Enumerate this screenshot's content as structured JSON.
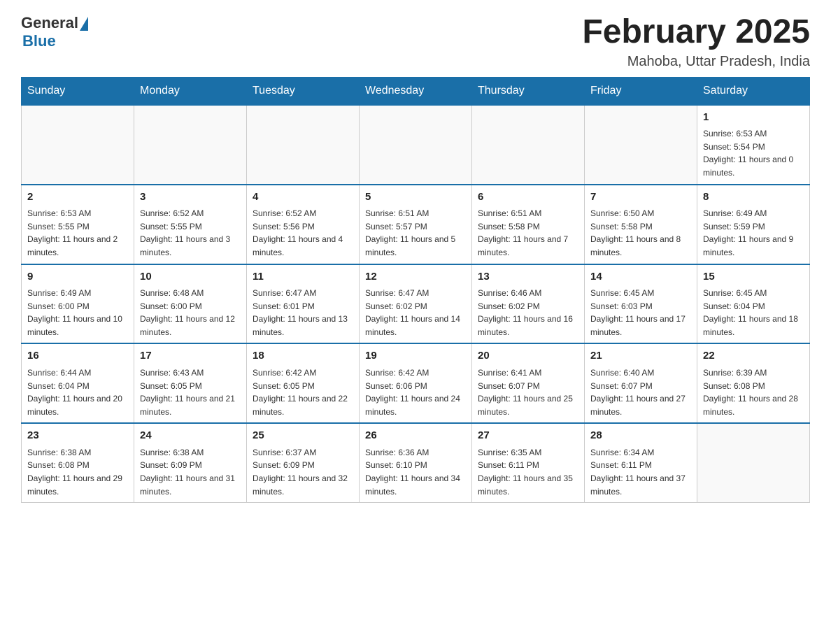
{
  "header": {
    "logo_general": "General",
    "logo_blue": "Blue",
    "month_title": "February 2025",
    "location": "Mahoba, Uttar Pradesh, India"
  },
  "days_of_week": [
    "Sunday",
    "Monday",
    "Tuesday",
    "Wednesday",
    "Thursday",
    "Friday",
    "Saturday"
  ],
  "weeks": [
    [
      {
        "day": "",
        "sunrise": "",
        "sunset": "",
        "daylight": ""
      },
      {
        "day": "",
        "sunrise": "",
        "sunset": "",
        "daylight": ""
      },
      {
        "day": "",
        "sunrise": "",
        "sunset": "",
        "daylight": ""
      },
      {
        "day": "",
        "sunrise": "",
        "sunset": "",
        "daylight": ""
      },
      {
        "day": "",
        "sunrise": "",
        "sunset": "",
        "daylight": ""
      },
      {
        "day": "",
        "sunrise": "",
        "sunset": "",
        "daylight": ""
      },
      {
        "day": "1",
        "sunrise": "Sunrise: 6:53 AM",
        "sunset": "Sunset: 5:54 PM",
        "daylight": "Daylight: 11 hours and 0 minutes."
      }
    ],
    [
      {
        "day": "2",
        "sunrise": "Sunrise: 6:53 AM",
        "sunset": "Sunset: 5:55 PM",
        "daylight": "Daylight: 11 hours and 2 minutes."
      },
      {
        "day": "3",
        "sunrise": "Sunrise: 6:52 AM",
        "sunset": "Sunset: 5:55 PM",
        "daylight": "Daylight: 11 hours and 3 minutes."
      },
      {
        "day": "4",
        "sunrise": "Sunrise: 6:52 AM",
        "sunset": "Sunset: 5:56 PM",
        "daylight": "Daylight: 11 hours and 4 minutes."
      },
      {
        "day": "5",
        "sunrise": "Sunrise: 6:51 AM",
        "sunset": "Sunset: 5:57 PM",
        "daylight": "Daylight: 11 hours and 5 minutes."
      },
      {
        "day": "6",
        "sunrise": "Sunrise: 6:51 AM",
        "sunset": "Sunset: 5:58 PM",
        "daylight": "Daylight: 11 hours and 7 minutes."
      },
      {
        "day": "7",
        "sunrise": "Sunrise: 6:50 AM",
        "sunset": "Sunset: 5:58 PM",
        "daylight": "Daylight: 11 hours and 8 minutes."
      },
      {
        "day": "8",
        "sunrise": "Sunrise: 6:49 AM",
        "sunset": "Sunset: 5:59 PM",
        "daylight": "Daylight: 11 hours and 9 minutes."
      }
    ],
    [
      {
        "day": "9",
        "sunrise": "Sunrise: 6:49 AM",
        "sunset": "Sunset: 6:00 PM",
        "daylight": "Daylight: 11 hours and 10 minutes."
      },
      {
        "day": "10",
        "sunrise": "Sunrise: 6:48 AM",
        "sunset": "Sunset: 6:00 PM",
        "daylight": "Daylight: 11 hours and 12 minutes."
      },
      {
        "day": "11",
        "sunrise": "Sunrise: 6:47 AM",
        "sunset": "Sunset: 6:01 PM",
        "daylight": "Daylight: 11 hours and 13 minutes."
      },
      {
        "day": "12",
        "sunrise": "Sunrise: 6:47 AM",
        "sunset": "Sunset: 6:02 PM",
        "daylight": "Daylight: 11 hours and 14 minutes."
      },
      {
        "day": "13",
        "sunrise": "Sunrise: 6:46 AM",
        "sunset": "Sunset: 6:02 PM",
        "daylight": "Daylight: 11 hours and 16 minutes."
      },
      {
        "day": "14",
        "sunrise": "Sunrise: 6:45 AM",
        "sunset": "Sunset: 6:03 PM",
        "daylight": "Daylight: 11 hours and 17 minutes."
      },
      {
        "day": "15",
        "sunrise": "Sunrise: 6:45 AM",
        "sunset": "Sunset: 6:04 PM",
        "daylight": "Daylight: 11 hours and 18 minutes."
      }
    ],
    [
      {
        "day": "16",
        "sunrise": "Sunrise: 6:44 AM",
        "sunset": "Sunset: 6:04 PM",
        "daylight": "Daylight: 11 hours and 20 minutes."
      },
      {
        "day": "17",
        "sunrise": "Sunrise: 6:43 AM",
        "sunset": "Sunset: 6:05 PM",
        "daylight": "Daylight: 11 hours and 21 minutes."
      },
      {
        "day": "18",
        "sunrise": "Sunrise: 6:42 AM",
        "sunset": "Sunset: 6:05 PM",
        "daylight": "Daylight: 11 hours and 22 minutes."
      },
      {
        "day": "19",
        "sunrise": "Sunrise: 6:42 AM",
        "sunset": "Sunset: 6:06 PM",
        "daylight": "Daylight: 11 hours and 24 minutes."
      },
      {
        "day": "20",
        "sunrise": "Sunrise: 6:41 AM",
        "sunset": "Sunset: 6:07 PM",
        "daylight": "Daylight: 11 hours and 25 minutes."
      },
      {
        "day": "21",
        "sunrise": "Sunrise: 6:40 AM",
        "sunset": "Sunset: 6:07 PM",
        "daylight": "Daylight: 11 hours and 27 minutes."
      },
      {
        "day": "22",
        "sunrise": "Sunrise: 6:39 AM",
        "sunset": "Sunset: 6:08 PM",
        "daylight": "Daylight: 11 hours and 28 minutes."
      }
    ],
    [
      {
        "day": "23",
        "sunrise": "Sunrise: 6:38 AM",
        "sunset": "Sunset: 6:08 PM",
        "daylight": "Daylight: 11 hours and 29 minutes."
      },
      {
        "day": "24",
        "sunrise": "Sunrise: 6:38 AM",
        "sunset": "Sunset: 6:09 PM",
        "daylight": "Daylight: 11 hours and 31 minutes."
      },
      {
        "day": "25",
        "sunrise": "Sunrise: 6:37 AM",
        "sunset": "Sunset: 6:09 PM",
        "daylight": "Daylight: 11 hours and 32 minutes."
      },
      {
        "day": "26",
        "sunrise": "Sunrise: 6:36 AM",
        "sunset": "Sunset: 6:10 PM",
        "daylight": "Daylight: 11 hours and 34 minutes."
      },
      {
        "day": "27",
        "sunrise": "Sunrise: 6:35 AM",
        "sunset": "Sunset: 6:11 PM",
        "daylight": "Daylight: 11 hours and 35 minutes."
      },
      {
        "day": "28",
        "sunrise": "Sunrise: 6:34 AM",
        "sunset": "Sunset: 6:11 PM",
        "daylight": "Daylight: 11 hours and 37 minutes."
      },
      {
        "day": "",
        "sunrise": "",
        "sunset": "",
        "daylight": ""
      }
    ]
  ]
}
